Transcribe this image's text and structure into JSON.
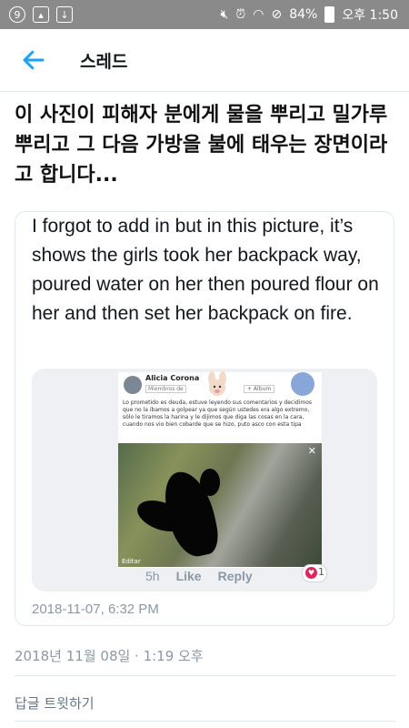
{
  "status_bar": {
    "battery": "84%",
    "time": "오후 1:50",
    "left_icons": [
      "nine-icon",
      "image-icon",
      "download-icon"
    ],
    "right_icons": [
      "mute-icon",
      "alarm-icon",
      "wifi-icon",
      "no-sign-icon",
      "battery-icon"
    ]
  },
  "app_bar": {
    "title": "스레드",
    "back_icon": "arrow-left-icon"
  },
  "tweet": {
    "text": "이 사진이 피해자 분에게 물을 뿌리고 밀가루 뿌리고 그 다음 가방을 불에 태우는 장면이라고 합니다...",
    "timestamp": "2018년 11월 08일 · 1:19 오후"
  },
  "quoted_tweet": {
    "text": "I forgot to add in but in this picture, it’s shows the girls took her backpack way, poured water on her then poured flour on her and then set her backpack on fire.",
    "date": "2018-11-07, 6:32 PM",
    "screenshot": {
      "name": "Alicia Corona",
      "members_label": "Miembros de",
      "album_label": "+ Álbum",
      "post_text": "Lo prometido es deuda, estuve leyendo sus comentarios y decidimos que no la íbamos a golpear ya que según ustedes era algo extremo, sólo le tiramos la harina y le dijimos que diga las cosas en la cara, cuando nos vio bien cobarde que se hizo, puto asco con esta tipa",
      "edit_label": "Editar",
      "time": "5h",
      "like_label": "Like",
      "reply_label": "Reply",
      "reaction_count": "1"
    }
  },
  "reply_button": {
    "label": "답글 트윗하기"
  },
  "colors": {
    "accent": "#1da1f2",
    "muted": "#8b98a5",
    "border": "#e1e8ed",
    "status_bar": "#8a8a8a"
  }
}
